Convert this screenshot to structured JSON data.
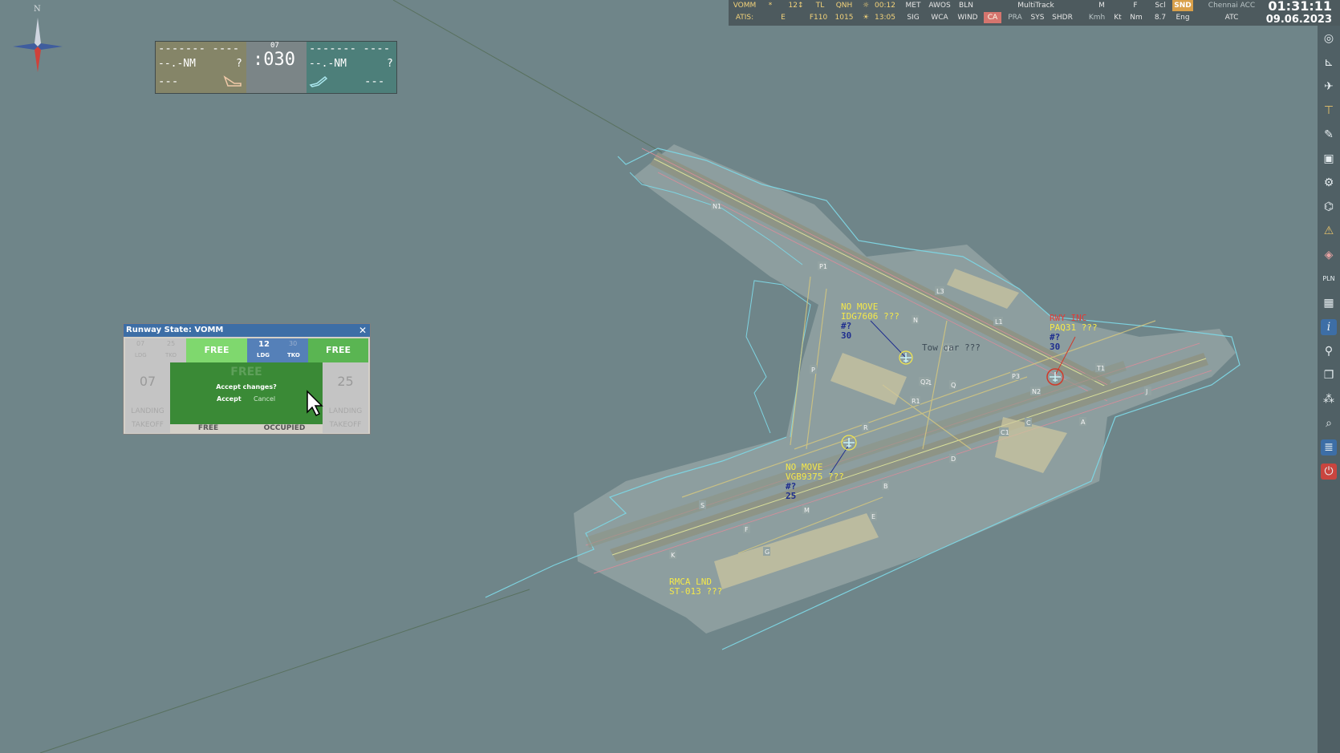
{
  "topbar": {
    "airport": "VOMM",
    "star": "*",
    "wind_val": "12↕",
    "tl": "TL",
    "qnh": "QNH",
    "atis_lbl": "ATIS:",
    "atis_code": "E",
    "tl_val": "F110",
    "qnh_val": "1015",
    "sunrise": "00:12",
    "sunset": "13:05",
    "met": "MET",
    "awos": "AWOS",
    "bln": "BLN",
    "sig": "SIG",
    "wca": "WCA",
    "wind": "WIND",
    "multitrack": "MultiTrack",
    "ca": "CA",
    "pra": "PRA",
    "sys": "SYS",
    "shdr": "SHDR",
    "m": "M",
    "f": "F",
    "scl": "Scl",
    "snd": "SND",
    "kmh": "Kmh",
    "kt": "Kt",
    "nm": "Nm",
    "scl_val": "8.7",
    "eng": "Eng",
    "sector": "Chennai ACC",
    "role": "ATC",
    "time": "01:31:11",
    "date": "09.06.2023"
  },
  "compass": {
    "north": "N"
  },
  "approach_panel": {
    "left_top": "------- ----",
    "left_dist": "--.-NM",
    "left_q": "?",
    "left_bottom": "---",
    "runway": "07",
    "wind_dir": ":030",
    "right_top": "------- ----",
    "right_dist": "--.-NM",
    "right_q": "?",
    "right_bottom": "---"
  },
  "runway_window": {
    "title": "Runway State: VOMM",
    "close": "✕",
    "rw1_a": "07",
    "rw1_b": "25",
    "ldg": "LDG",
    "tko": "TKO",
    "state1": "FREE",
    "rw2_a": "12",
    "rw2_b": "30",
    "state2": "FREE",
    "rwy_left": "07",
    "rwy_right": "25",
    "ghost_state": "FREE",
    "accept_prompt": "Accept changes?",
    "accept": "Accept",
    "cancel": "Cancel",
    "landing": "LANDING",
    "takeoff": "TAKEOFF",
    "bottom_free": "FREE",
    "bottom_occupied": "OCCUPIED"
  },
  "map_tags": [
    {
      "lines": [
        "NO MOVE",
        "IDG7606 ???",
        "#?",
        "30"
      ]
    },
    {
      "lines": [
        "Tow car ???"
      ]
    },
    {
      "lines": [
        "RWY INC",
        "PAQ31 ???",
        "#?",
        "30"
      ]
    },
    {
      "lines": [
        "NO MOVE",
        "VGB9375 ???",
        "#?",
        "25"
      ]
    },
    {
      "lines": [
        "RMCA LND",
        "ST-013 ???"
      ]
    }
  ],
  "taxi_labels": [
    "N1",
    "P1",
    "P",
    "N",
    "L3",
    "L1",
    "Q1",
    "Q2",
    "Q",
    "R1",
    "R",
    "P3",
    "N2",
    "T1",
    "J",
    "A",
    "C",
    "C1",
    "D",
    "B",
    "E",
    "F",
    "G",
    "H",
    "K",
    "S",
    "M"
  ],
  "icons": [
    "target-icon",
    "ruler-icon",
    "aircraft-icon",
    "crane-icon",
    "pen-icon",
    "vehicle-icon",
    "settings-icon",
    "plane-list-icon",
    "alert-icon",
    "map-icon",
    "pln-icon",
    "layout-icon",
    "info-icon",
    "lock-icon",
    "layers-icon",
    "grid-icon",
    "search-icon",
    "list-icon",
    "power-icon"
  ]
}
